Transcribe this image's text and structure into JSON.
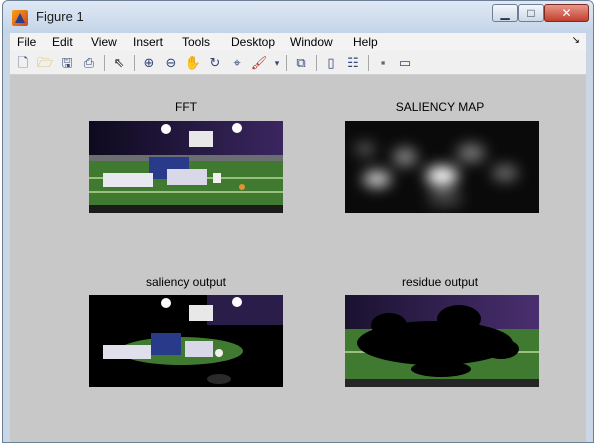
{
  "window": {
    "title": "Figure 1",
    "controls": {
      "minimize": "▁",
      "maximize": "□",
      "close": "✕"
    }
  },
  "menubar": {
    "items": [
      "File",
      "Edit",
      "View",
      "Insert",
      "Tools",
      "Desktop",
      "Window",
      "Help"
    ],
    "overflow": "↘"
  },
  "toolbar": {
    "icons": [
      "new-figure-icon",
      "open-file-icon",
      "save-icon",
      "print-icon",
      "edit-plot-arrow-icon",
      "zoom-in-icon",
      "zoom-out-icon",
      "pan-hand-icon",
      "rotate-3d-icon",
      "data-cursor-icon",
      "brush-icon",
      "link-plot-icon",
      "colorbar-icon",
      "legend-icon",
      "hide-plot-tools-icon",
      "show-plot-tools-icon"
    ]
  },
  "figure": {
    "panels": [
      {
        "title": "FFT"
      },
      {
        "title": "SALIENCY MAP"
      },
      {
        "title": "saliency output"
      },
      {
        "title": "residue output"
      }
    ]
  }
}
